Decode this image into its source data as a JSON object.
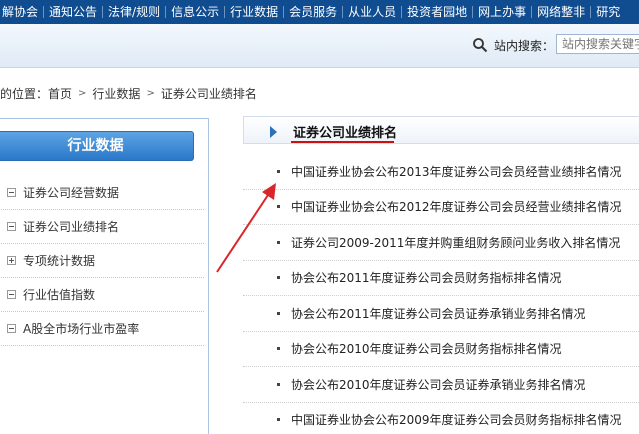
{
  "topnav": {
    "items": [
      "解协会",
      "通知公告",
      "法律/规则",
      "信息公示",
      "行业数据",
      "会员服务",
      "从业人员",
      "投资者园地",
      "网上办事",
      "网络整非",
      "研究"
    ]
  },
  "search": {
    "label": "站内搜索：",
    "placeholder": "站内搜索关键字"
  },
  "breadcrumb": {
    "prefix": "的位置：",
    "items": [
      "首页",
      "行业数据",
      "证券公司业绩排名"
    ]
  },
  "sidebar": {
    "title": "行业数据",
    "items": [
      {
        "label": "证券公司经营数据",
        "marker": "minus"
      },
      {
        "label": "证券公司业绩排名",
        "marker": "minus"
      },
      {
        "label": "专项统计数据",
        "marker": "plus"
      },
      {
        "label": "行业估值指数",
        "marker": "minus"
      },
      {
        "label": "A股全市场行业市盈率",
        "marker": "minus"
      }
    ]
  },
  "main": {
    "title": "证券公司业绩排名",
    "articles": [
      "中国证券业协会公布2013年度证券公司会员经营业绩排名情况",
      "中国证券业协会公布2012年度证券公司会员经营业绩排名情况",
      "证券公司2009-2011年度并购重组财务顾问业务收入排名情况",
      "协会公布2011年度证券公司会员财务指标排名情况",
      "协会公布2011年度证券公司会员证券承销业务排名情况",
      "协会公布2010年度证券公司会员财务指标排名情况",
      "协会公布2010年度证券公司会员证券承销业务排名情况",
      "中国证券业协会公布2009年度证券公司会员财务指标排名情况"
    ]
  },
  "colors": {
    "nav_bg": "#0f4c90",
    "sidebar_header": "#2a78c9",
    "title_underline": "#cc1111",
    "annotation_arrow": "#d9262a"
  }
}
